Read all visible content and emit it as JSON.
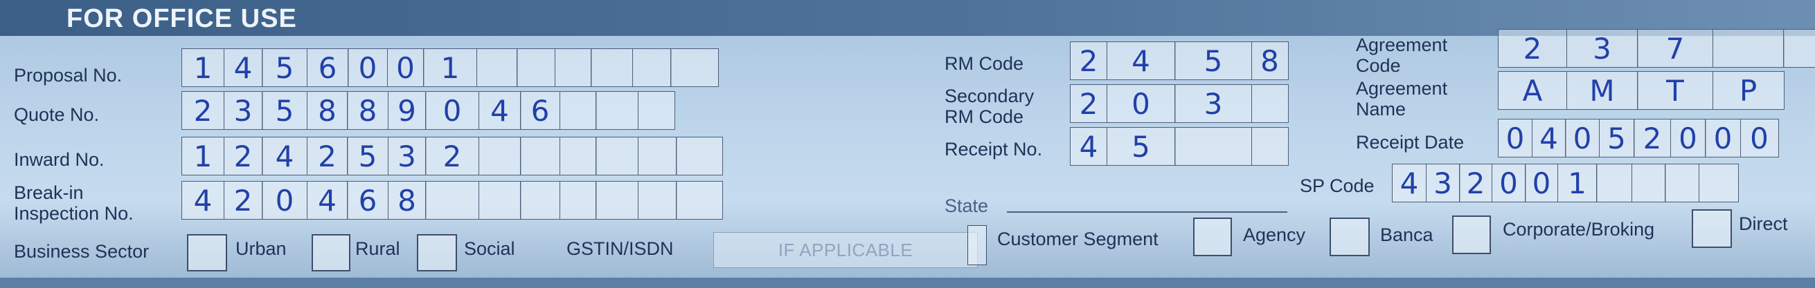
{
  "header": {
    "title": "FOR OFFICE USE"
  },
  "left_section": {
    "proposal_no": {
      "label": "Proposal No.",
      "values": [
        "1",
        "4",
        "5",
        "6",
        "0",
        "0",
        "1",
        "",
        "",
        "",
        "",
        "",
        ""
      ]
    },
    "quote_no": {
      "label": "Quote No.",
      "values": [
        "2",
        "3",
        "5",
        "8",
        "8",
        "9",
        "0",
        "4",
        "6",
        "",
        "",
        ""
      ]
    },
    "inward_no": {
      "label": "Inward No.",
      "values": [
        "1",
        "2",
        "4",
        "2",
        "5",
        "3",
        "2",
        "",
        "",
        "",
        "",
        "",
        ""
      ]
    },
    "break_in": {
      "label_line1": "Break-in",
      "label_line2": "Inspection No.",
      "values": [
        "4",
        "2",
        "0",
        "4",
        "6",
        "8",
        "",
        "",
        "",
        "",
        "",
        "",
        ""
      ]
    }
  },
  "middle_section": {
    "rm_code": {
      "label": "RM Code",
      "values": [
        "2",
        "4",
        "5",
        "8"
      ]
    },
    "secondary_rm_code": {
      "label_line1": "Secondary",
      "label_line2": "RM Code",
      "values": [
        "2",
        "0",
        "3",
        ""
      ]
    },
    "receipt_no": {
      "label": "Receipt No.",
      "values": [
        "4",
        "5",
        "",
        ""
      ]
    },
    "state": {
      "label": "State",
      "value": ""
    }
  },
  "right_section": {
    "agreement_code": {
      "label_line1": "Agreement",
      "label_line2": "Code",
      "values": [
        "2",
        "3",
        "7",
        "",
        ""
      ]
    },
    "agreement_name": {
      "label_line1": "Agreement",
      "label_line2": "Name",
      "values": [
        "A",
        "M",
        "T",
        "P"
      ]
    },
    "receipt_date": {
      "label": "Receipt Date",
      "values": [
        "0",
        "4",
        "0",
        "5",
        "2",
        "0",
        "0",
        "0"
      ]
    },
    "sp_code": {
      "label": "SP Code",
      "values": [
        "4",
        "3",
        "2",
        "0",
        "0",
        "1",
        "",
        "",
        "",
        ""
      ]
    }
  },
  "business_sector": {
    "label": "Business Sector",
    "options": [
      "Urban",
      "Rural",
      "Social"
    ],
    "gstin_label": "GSTIN/ISDN",
    "gstin_placeholder": "IF APPLICABLE"
  },
  "customer_segment": {
    "label": "Customer Segment",
    "options": [
      "Agency",
      "Banca",
      "Corporate/Broking",
      "Direct"
    ]
  }
}
